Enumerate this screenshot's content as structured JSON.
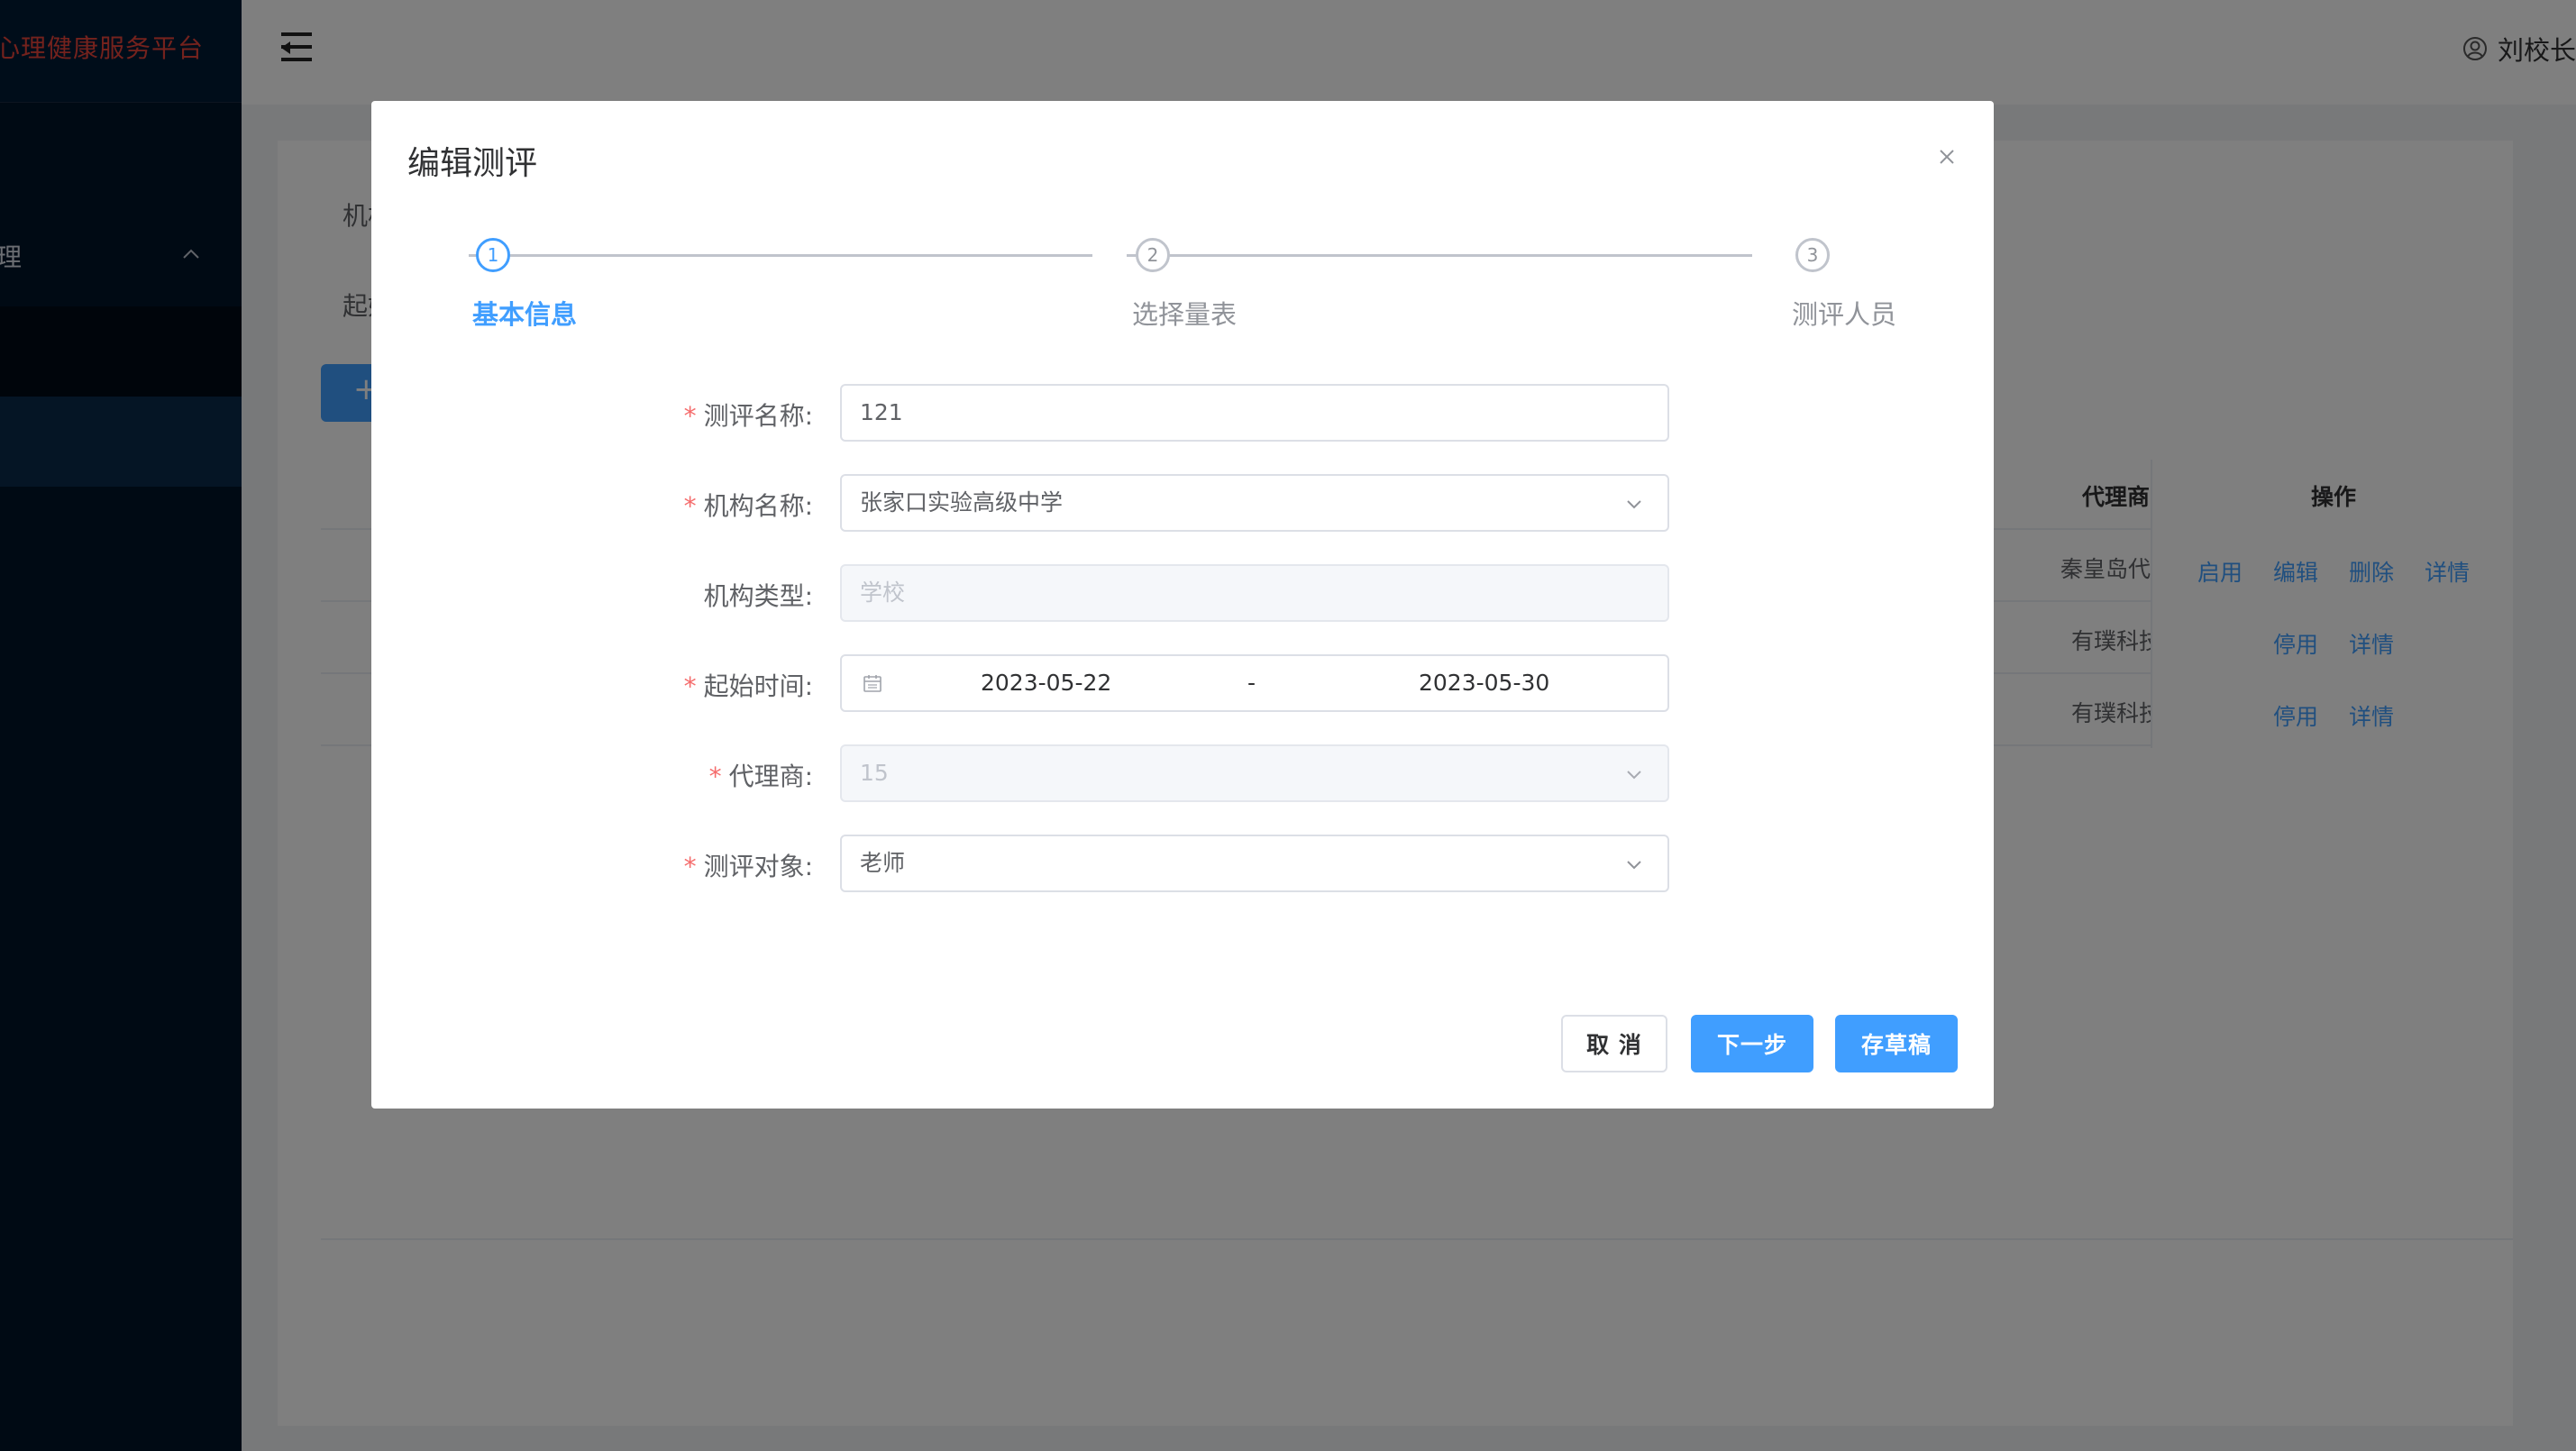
{
  "sidebar": {
    "brand": "心理健康服务平台",
    "menu_group_label": "理"
  },
  "header": {
    "user_name": "刘校长"
  },
  "background": {
    "filter_label_1": "机构",
    "filter_label_2": "起始",
    "add_button": "+",
    "table": {
      "col_agent": "代理商",
      "col_actions": "操作",
      "rows": [
        {
          "agent": "秦皇岛代理",
          "actions": [
            "启用",
            "编辑",
            "删除",
            "详情"
          ]
        },
        {
          "agent": "有璞科技",
          "actions": [
            "停用",
            "详情"
          ]
        },
        {
          "agent": "有璞科技",
          "actions": [
            "停用",
            "详情"
          ]
        }
      ]
    }
  },
  "dialog": {
    "title": "编辑测评",
    "steps": [
      {
        "num": "1",
        "title": "基本信息",
        "active": true
      },
      {
        "num": "2",
        "title": "选择量表",
        "active": false
      },
      {
        "num": "3",
        "title": "测评人员",
        "active": false
      }
    ],
    "form": {
      "name": {
        "label": "测评名称:",
        "required": true,
        "value": "121"
      },
      "org": {
        "label": "机构名称:",
        "required": true,
        "value": "张家口实验高级中学"
      },
      "org_type": {
        "label": "机构类型:",
        "required": false,
        "value": "学校"
      },
      "date": {
        "label": "起始时间:",
        "required": true,
        "start": "2023-05-22",
        "separator": "-",
        "end": "2023-05-30"
      },
      "agent": {
        "label": "代理商:",
        "required": true,
        "value": "15"
      },
      "target": {
        "label": "测评对象:",
        "required": true,
        "value": "老师"
      }
    },
    "required_mark": "*",
    "buttons": {
      "cancel": "取 消",
      "next": "下一步",
      "draft": "存草稿"
    }
  },
  "colors": {
    "primary": "#409eff",
    "danger": "#f56c6c",
    "sidebar_bg": "#001529",
    "brand_red": "#e8443b"
  }
}
